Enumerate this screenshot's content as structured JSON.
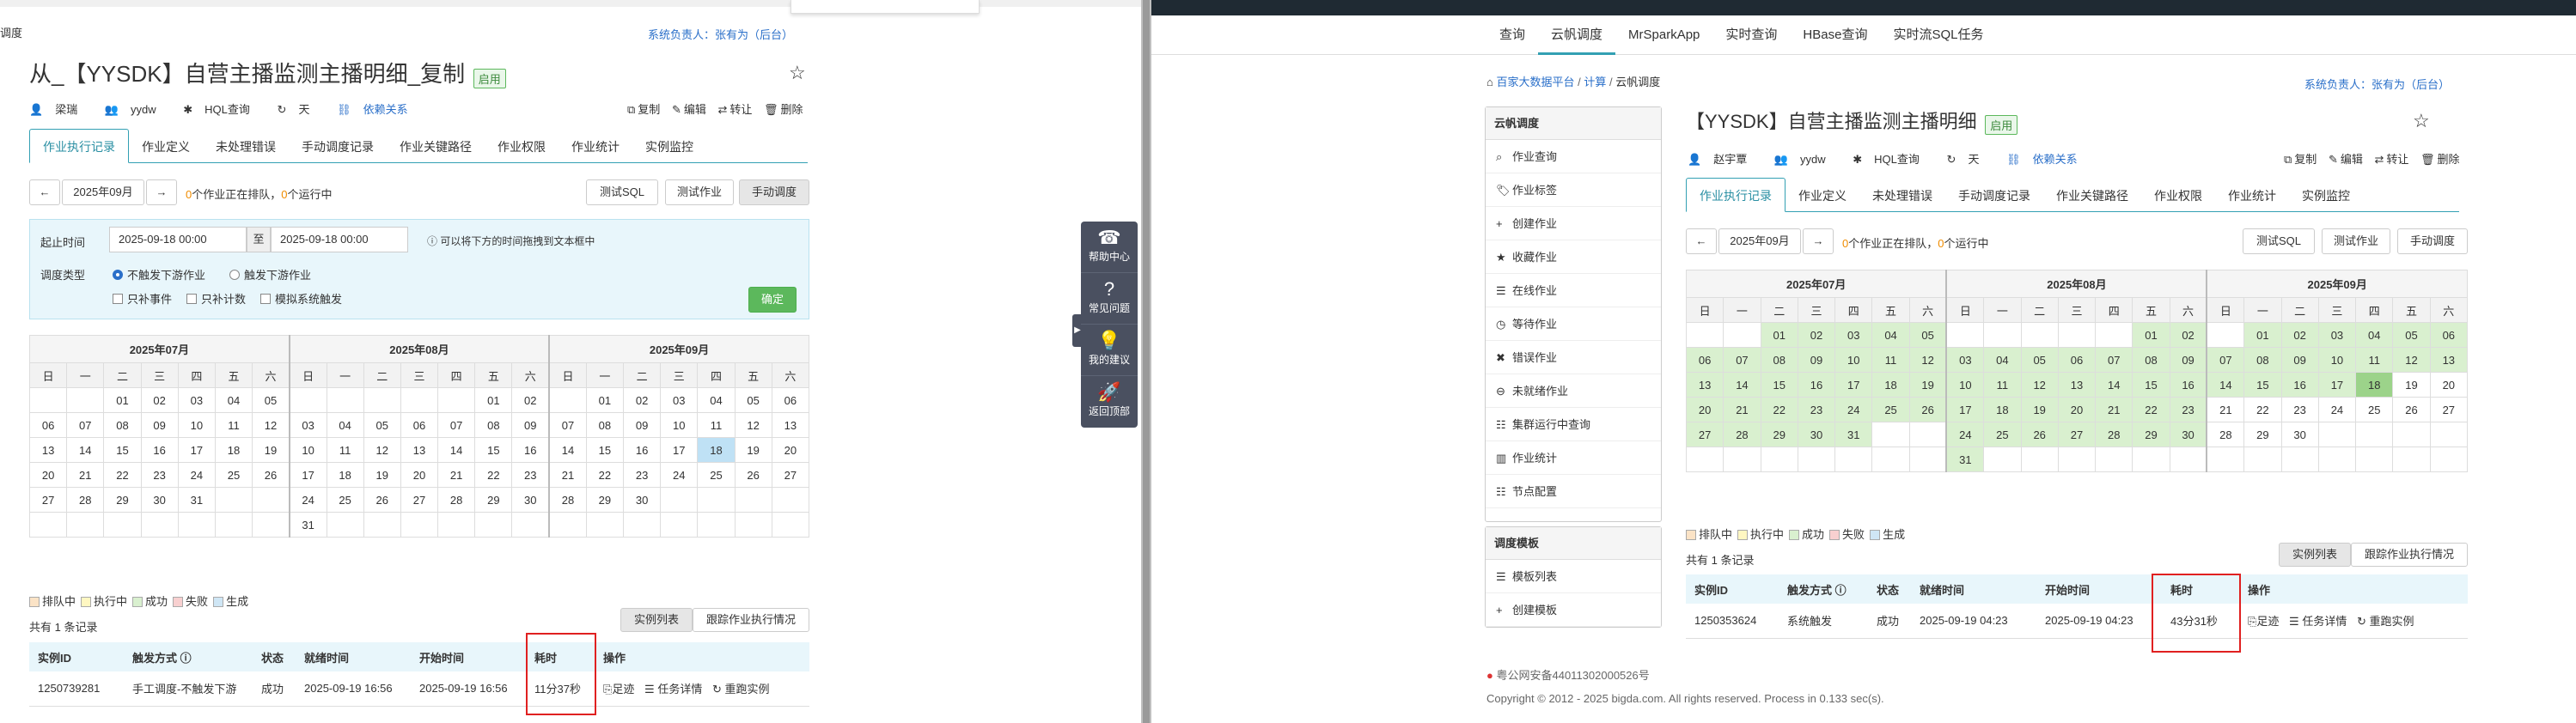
{
  "left": {
    "top_cut_text": "调度",
    "owner_label": "系统负责人：张有为（后台）",
    "title": "从_【YYSDK】自营主播监测主播明细_复制",
    "status_badge": "启用",
    "meta": {
      "user": "梁瑞",
      "group": "yydw",
      "query_type": "HQL查询",
      "period": "天",
      "dependency": "依赖关系"
    },
    "actions": {
      "copy": "复制",
      "edit": "编辑",
      "transfer": "转让",
      "delete": "删除"
    },
    "tabs": [
      "作业执行记录",
      "作业定义",
      "未处理错误",
      "手动调度记录",
      "作业关键路径",
      "作业权限",
      "作业统计",
      "实例监控"
    ],
    "month_nav": "2025年09月",
    "queue_text": {
      "a": "0",
      "b": "个作业正在排队，",
      "c": "0",
      "d": "个运行中"
    },
    "buttons": {
      "test_sql": "测试SQL",
      "test_job": "测试作业",
      "manual": "手动调度"
    },
    "filter": {
      "time_label": "起止时间",
      "start": "2025-09-18 00:00",
      "to": "至",
      "end": "2025-09-18 00:00",
      "hint": "可以将下方的时间拖拽到文本框中",
      "type_label": "调度类型",
      "radio1": "不触发下游作业",
      "radio2": "触发下游作业",
      "chk1": "只补事件",
      "chk2": "只补计数",
      "chk3": "模拟系统触发",
      "confirm": "确定"
    },
    "legend": [
      "排队中",
      "执行中",
      "成功",
      "失败",
      "生成"
    ],
    "record_count": "共有 1 条记录",
    "view_buttons": {
      "list": "实例列表",
      "trace": "跟踪作业执行情况"
    },
    "table": {
      "headers": [
        "实例ID",
        "触发方式",
        "状态",
        "就绪时间",
        "开始时间",
        "耗时",
        "操作"
      ],
      "row": {
        "id": "1250739281",
        "trigger": "手工调度-不触发下游",
        "status": "成功",
        "ready": "2025-09-19 16:56",
        "start": "2025-09-19 16:56",
        "duration": "11分37秒",
        "op1": "足迹",
        "op2": "任务详情",
        "op3": "重跑实例"
      }
    }
  },
  "calendar": {
    "months": [
      "2025年07月",
      "2025年08月",
      "2025年09月"
    ],
    "weekdays": [
      "日",
      "一",
      "二",
      "三",
      "四",
      "五",
      "六"
    ]
  },
  "float_widget": [
    "帮助中心",
    "常见问题",
    "我的建议",
    "返回顶部"
  ],
  "right": {
    "nav": [
      "查询",
      "云帆调度",
      "MrSparkApp",
      "实时查询",
      "HBase查询",
      "实时流SQL任务"
    ],
    "breadcrumb": [
      "百家大数据平台",
      "计算",
      "云帆调度"
    ],
    "owner_label": "系统负责人：张有为（后台）",
    "sidebar_title": "云帆调度",
    "sidebar": [
      "作业查询",
      "作业标签",
      "创建作业",
      "收藏作业",
      "在线作业",
      "等待作业",
      "错误作业",
      "未就绪作业",
      "集群运行中查询",
      "作业统计",
      "节点配置"
    ],
    "template_title": "调度模板",
    "template_items": [
      "模板列表",
      "创建模板"
    ],
    "title": "【YYSDK】自营主播监测主播明细",
    "status_badge": "启用",
    "meta": {
      "user": "赵宇覃",
      "group": "yydw",
      "query_type": "HQL查询",
      "period": "天",
      "dependency": "依赖关系"
    },
    "actions": {
      "copy": "复制",
      "edit": "编辑",
      "transfer": "转让",
      "delete": "删除"
    },
    "tabs": [
      "作业执行记录",
      "作业定义",
      "未处理错误",
      "手动调度记录",
      "作业关键路径",
      "作业权限",
      "作业统计",
      "实例监控"
    ],
    "month_nav": "2025年09月",
    "queue_text": {
      "a": "0",
      "b": "个作业正在排队，",
      "c": "0",
      "d": "个运行中"
    },
    "buttons": {
      "test_sql": "测试SQL",
      "test_job": "测试作业",
      "manual": "手动调度"
    },
    "legend": [
      "排队中",
      "执行中",
      "成功",
      "失败",
      "生成"
    ],
    "record_count": "共有 1 条记录",
    "view_buttons": {
      "list": "实例列表",
      "trace": "跟踪作业执行情况"
    },
    "table": {
      "headers": [
        "实例ID",
        "触发方式",
        "状态",
        "就绪时间",
        "开始时间",
        "耗时",
        "操作"
      ],
      "row": {
        "id": "1250353624",
        "trigger": "系统触发",
        "status": "成功",
        "ready": "2025-09-19 04:23",
        "start": "2025-09-19 04:23",
        "duration": "43分31秒",
        "op1": "足迹",
        "op2": "任务详情",
        "op3": "重跑实例"
      }
    },
    "footer_icp": "粤公网安备44011302000526号",
    "footer_copy": "Copyright © 2012 - 2025 bigda.com. All rights reserved. Process in 0.133 sec(s)."
  },
  "colors": {
    "accent": "#33a0b3",
    "success": "#5cb85c",
    "highlight": "#e02020",
    "link": "#2a6fc9"
  }
}
